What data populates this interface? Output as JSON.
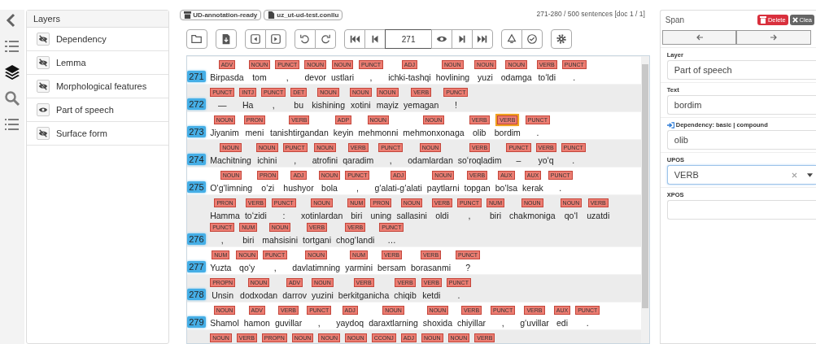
{
  "rail": [
    {
      "selected": false
    },
    {
      "selected": false
    },
    {
      "selected": true
    },
    {
      "selected": false
    },
    {
      "selected": false
    }
  ],
  "layers": {
    "title": "Layers",
    "items": [
      {
        "label": "Dependency",
        "visible": false
      },
      {
        "label": "Lemma",
        "visible": false
      },
      {
        "label": "Morphological features",
        "visible": false
      },
      {
        "label": "Part of speech",
        "visible": true
      },
      {
        "label": "Surface form",
        "visible": false
      }
    ]
  },
  "documents": [
    "UD-annotation-ready",
    "uz_ut-ud-test.conllu"
  ],
  "range": "271-280 / 500 sentences [doc 1 / 1]",
  "page": "271",
  "sentences": [
    {
      "number": "271",
      "tokens": [
        {
          "text": "Birpasda",
          "pos": "ADV",
          "selected": false
        },
        {
          "text": "tom",
          "pos": "NOUN",
          "selected": false
        },
        {
          "text": ",",
          "pos": "PUNCT",
          "selected": false
        },
        {
          "text": "devor",
          "pos": "NOUN",
          "selected": false
        },
        {
          "text": "ustlari",
          "pos": "NOUN",
          "selected": false
        },
        {
          "text": ",",
          "pos": "PUNCT",
          "selected": false
        },
        {
          "text": "ichki-tashqi",
          "pos": "ADJ",
          "selected": false
        },
        {
          "text": "hovlining",
          "pos": "NOUN",
          "selected": false
        },
        {
          "text": "yuzi",
          "pos": "NOUN",
          "selected": false
        },
        {
          "text": "odamga",
          "pos": "NOUN",
          "selected": false
        },
        {
          "text": "toʻldi",
          "pos": "VERB",
          "selected": false
        },
        {
          "text": ".",
          "pos": "PUNCT",
          "selected": false
        }
      ]
    },
    {
      "number": "272",
      "tokens": [
        {
          "text": "—",
          "pos": "PUNCT",
          "selected": false
        },
        {
          "text": "Ha",
          "pos": "INTJ",
          "selected": false
        },
        {
          "text": ",",
          "pos": "PUNCT",
          "selected": false
        },
        {
          "text": "bu",
          "pos": "DET",
          "selected": false
        },
        {
          "text": "kishining",
          "pos": "NOUN",
          "selected": false
        },
        {
          "text": "xotini",
          "pos": "NOUN",
          "selected": false
        },
        {
          "text": "mayiz",
          "pos": "NOUN",
          "selected": false
        },
        {
          "text": "yemagan",
          "pos": "VERB",
          "selected": false
        },
        {
          "text": "!",
          "pos": "PUNCT",
          "selected": false
        }
      ]
    },
    {
      "number": "273",
      "tokens": [
        {
          "text": "Jiyanim",
          "pos": "NOUN",
          "selected": false
        },
        {
          "text": "meni",
          "pos": "PRON",
          "selected": false
        },
        {
          "text": "tanishtirgandan",
          "pos": "VERB",
          "selected": false
        },
        {
          "text": "keyin",
          "pos": "ADP",
          "selected": false
        },
        {
          "text": "mehmonni",
          "pos": "NOUN",
          "selected": false
        },
        {
          "text": "mehmonxonaga",
          "pos": "NOUN",
          "selected": false
        },
        {
          "text": "olib",
          "pos": "VERB",
          "selected": false
        },
        {
          "text": "bordim",
          "pos": "VERB",
          "selected": true
        },
        {
          "text": ".",
          "pos": "PUNCT",
          "selected": false
        }
      ]
    },
    {
      "number": "274",
      "tokens": [
        {
          "text": "Machitning",
          "pos": "NOUN",
          "selected": false
        },
        {
          "text": "ichini",
          "pos": "NOUN",
          "selected": false
        },
        {
          "text": ",",
          "pos": "PUNCT",
          "selected": false
        },
        {
          "text": "atrofini",
          "pos": "NOUN",
          "selected": false
        },
        {
          "text": "qaradim",
          "pos": "VERB",
          "selected": false
        },
        {
          "text": ",",
          "pos": "PUNCT",
          "selected": false
        },
        {
          "text": "odamlardan",
          "pos": "NOUN",
          "selected": false
        },
        {
          "text": "soʻroqladim",
          "pos": "VERB",
          "selected": false
        },
        {
          "text": "–",
          "pos": "PUNCT",
          "selected": false
        },
        {
          "text": "yoʻq",
          "pos": "VERB",
          "selected": false
        },
        {
          "text": ".",
          "pos": "PUNCT",
          "selected": false
        }
      ]
    },
    {
      "number": "275",
      "tokens": [
        {
          "text": "Oʻgʻlimning",
          "pos": "NOUN",
          "selected": false
        },
        {
          "text": "oʻzi",
          "pos": "PRON",
          "selected": false
        },
        {
          "text": "hushyor",
          "pos": "ADJ",
          "selected": false
        },
        {
          "text": "bola",
          "pos": "NOUN",
          "selected": false
        },
        {
          "text": ",",
          "pos": "PUNCT",
          "selected": false
        },
        {
          "text": "gʻalati-gʻalati",
          "pos": "ADJ",
          "selected": false
        },
        {
          "text": "paytlarni",
          "pos": "NOUN",
          "selected": false
        },
        {
          "text": "topgan",
          "pos": "VERB",
          "selected": false
        },
        {
          "text": "boʻlsa",
          "pos": "AUX",
          "selected": false
        },
        {
          "text": "kerak",
          "pos": "AUX",
          "selected": false
        },
        {
          "text": ".",
          "pos": "PUNCT",
          "selected": false
        }
      ]
    },
    {
      "number": "276",
      "tokens": [
        {
          "text": "Hamma",
          "pos": "PRON",
          "selected": false
        },
        {
          "text": "toʻzidi",
          "pos": "VERB",
          "selected": false
        },
        {
          "text": ":",
          "pos": "PUNCT",
          "selected": false
        },
        {
          "text": "xotinlardan",
          "pos": "NOUN",
          "selected": false
        },
        {
          "text": "biri",
          "pos": "NUM",
          "selected": false
        },
        {
          "text": "uning",
          "pos": "PRON",
          "selected": false
        },
        {
          "text": "sallasini",
          "pos": "NOUN",
          "selected": false
        },
        {
          "text": "oldi",
          "pos": "VERB",
          "selected": false
        },
        {
          "text": ",",
          "pos": "PUNCT",
          "selected": false
        },
        {
          "text": "biri",
          "pos": "NUM",
          "selected": false
        },
        {
          "text": "chakmoniga",
          "pos": "NOUN",
          "selected": false
        },
        {
          "text": "qoʻl",
          "pos": "NOUN",
          "selected": false
        },
        {
          "text": "uzatdi",
          "pos": "VERB",
          "selected": false
        },
        {
          "text": ",",
          "pos": "PUNCT",
          "selected": false
        },
        {
          "text": "biri",
          "pos": "NUM",
          "selected": false
        },
        {
          "text": "mahsisini",
          "pos": "NOUN",
          "selected": false
        },
        {
          "text": "tortgani",
          "pos": "VERB",
          "selected": false
        },
        {
          "text": "chogʻlandi",
          "pos": "VERB",
          "selected": false
        },
        {
          "text": "…",
          "pos": "PUNCT",
          "selected": false
        }
      ]
    },
    {
      "number": "277",
      "tokens": [
        {
          "text": "Yuzta",
          "pos": "NUM",
          "selected": false
        },
        {
          "text": "qoʻy",
          "pos": "NOUN",
          "selected": false
        },
        {
          "text": ",",
          "pos": "PUNCT",
          "selected": false
        },
        {
          "text": "davlatimning",
          "pos": "NOUN",
          "selected": false
        },
        {
          "text": "yarmini",
          "pos": "NUM",
          "selected": false
        },
        {
          "text": "bersam",
          "pos": "VERB",
          "selected": false
        },
        {
          "text": "borasanmi",
          "pos": "VERB",
          "selected": false
        },
        {
          "text": "?",
          "pos": "PUNCT",
          "selected": false
        }
      ]
    },
    {
      "number": "278",
      "tokens": [
        {
          "text": "Unsin",
          "pos": "PROPN",
          "selected": false
        },
        {
          "text": "dodxodan",
          "pos": "NOUN",
          "selected": false
        },
        {
          "text": "darrov",
          "pos": "ADV",
          "selected": false
        },
        {
          "text": "yuzini",
          "pos": "NOUN",
          "selected": false
        },
        {
          "text": "berkitganicha",
          "pos": "VERB",
          "selected": false
        },
        {
          "text": "chiqib",
          "pos": "VERB",
          "selected": false
        },
        {
          "text": "ketdi",
          "pos": "VERB",
          "selected": false
        },
        {
          "text": ".",
          "pos": "PUNCT",
          "selected": false
        }
      ]
    },
    {
      "number": "279",
      "tokens": [
        {
          "text": "Shamol",
          "pos": "NOUN",
          "selected": false
        },
        {
          "text": "hamon",
          "pos": "ADV",
          "selected": false
        },
        {
          "text": "guvillar",
          "pos": "VERB",
          "selected": false
        },
        {
          "text": ",",
          "pos": "PUNCT",
          "selected": false
        },
        {
          "text": "yaydoq",
          "pos": "ADJ",
          "selected": false
        },
        {
          "text": "daraxtlarning",
          "pos": "NOUN",
          "selected": false
        },
        {
          "text": "shoxida",
          "pos": "NOUN",
          "selected": false
        },
        {
          "text": "chiyillar",
          "pos": "VERB",
          "selected": false
        },
        {
          "text": ",",
          "pos": "PUNCT",
          "selected": false
        },
        {
          "text": "gʻuvillar",
          "pos": "VERB",
          "selected": false
        },
        {
          "text": "edi",
          "pos": "AUX",
          "selected": false
        },
        {
          "text": ".",
          "pos": "PUNCT",
          "selected": false
        }
      ]
    },
    {
      "tokens": [
        {
          "pos": "NOUN",
          "selected": false
        },
        {
          "pos": "VERB",
          "selected": false
        },
        {
          "pos": "PROPN",
          "selected": false
        },
        {
          "pos": "NOUN",
          "selected": false
        },
        {
          "pos": "NOUN",
          "selected": false
        },
        {
          "pos": "NOUN",
          "selected": false
        },
        {
          "pos": "CCONJ",
          "selected": false
        },
        {
          "pos": "ADJ",
          "selected": false
        },
        {
          "pos": "NOUN",
          "selected": false
        },
        {
          "pos": "NOUN",
          "selected": false
        },
        {
          "pos": "VERB",
          "selected": false
        }
      ]
    }
  ],
  "span_panel": {
    "title": "Span",
    "delete": "Delete",
    "clear": "Clea",
    "fields": [
      {
        "label": "Layer",
        "value": "Part of speech",
        "kind": "text",
        "focused": false
      },
      {
        "label": "Text",
        "value": "bordim",
        "kind": "text",
        "focused": false
      },
      {
        "label": "Dependency: basic | compound",
        "value": "olib",
        "kind": "relation",
        "focused": false
      },
      {
        "label": "UPOS",
        "value": "VERB",
        "kind": "combo",
        "focused": true
      },
      {
        "label": "XPOS",
        "kind": "text",
        "focused": false
      }
    ]
  }
}
